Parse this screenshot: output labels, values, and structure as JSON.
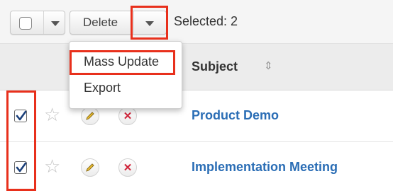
{
  "toolbar": {
    "delete_label": "Delete",
    "selected_text": "Selected: 2"
  },
  "menu": {
    "items": [
      {
        "label": "Mass Update"
      },
      {
        "label": "Export"
      }
    ]
  },
  "table": {
    "subject_header": "Subject",
    "rows": [
      {
        "subject": "Product Demo",
        "checked": true
      },
      {
        "subject": "Implementation Meeting",
        "checked": true
      }
    ]
  },
  "colors": {
    "highlight": "#e8301c",
    "link": "#2a6db5",
    "delete_x": "#d0243a"
  },
  "icons": [
    "checkbox-icon",
    "caret-down-icon",
    "sort-icon",
    "star-icon",
    "pencil-icon",
    "close-icon"
  ]
}
